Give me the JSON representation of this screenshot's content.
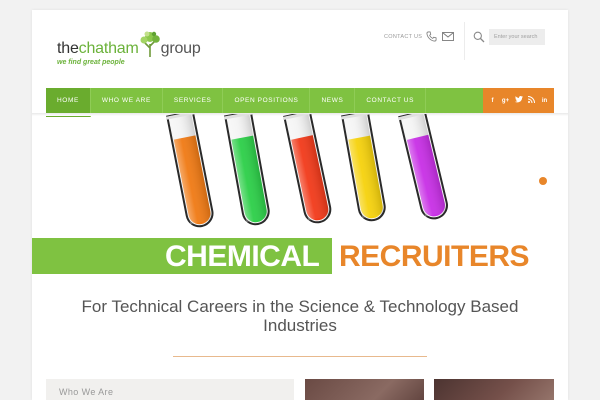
{
  "logo": {
    "word1": "the",
    "word2": "chatham",
    "word3": "group",
    "tagline": "we find great people"
  },
  "header": {
    "contact_label": "CONTACT US",
    "search_placeholder": "Enter your search"
  },
  "nav": {
    "items": [
      {
        "label": "HOME",
        "active": true
      },
      {
        "label": "WHO WE ARE",
        "active": false
      },
      {
        "label": "SERVICES",
        "active": false
      },
      {
        "label": "OPEN POSITIONS",
        "active": false
      },
      {
        "label": "NEWS",
        "active": false
      },
      {
        "label": "CONTACT US",
        "active": false
      }
    ],
    "social": [
      "f",
      "g+",
      "t",
      "rss",
      "in"
    ]
  },
  "hero": {
    "title_part1": "CHEMICAL",
    "title_part2": "RECRUITERS",
    "tube_colors": [
      "#f07a14",
      "#2ccf48",
      "#f23a1a",
      "#f6d20c",
      "#c82fe6"
    ]
  },
  "headline": "For Technical Careers in the Science & Technology Based Industries",
  "sections": {
    "who_we_are": "Who We Are"
  },
  "colors": {
    "brand_green": "#7fc241",
    "brand_orange": "#e8862a",
    "text_grey": "#555555"
  }
}
